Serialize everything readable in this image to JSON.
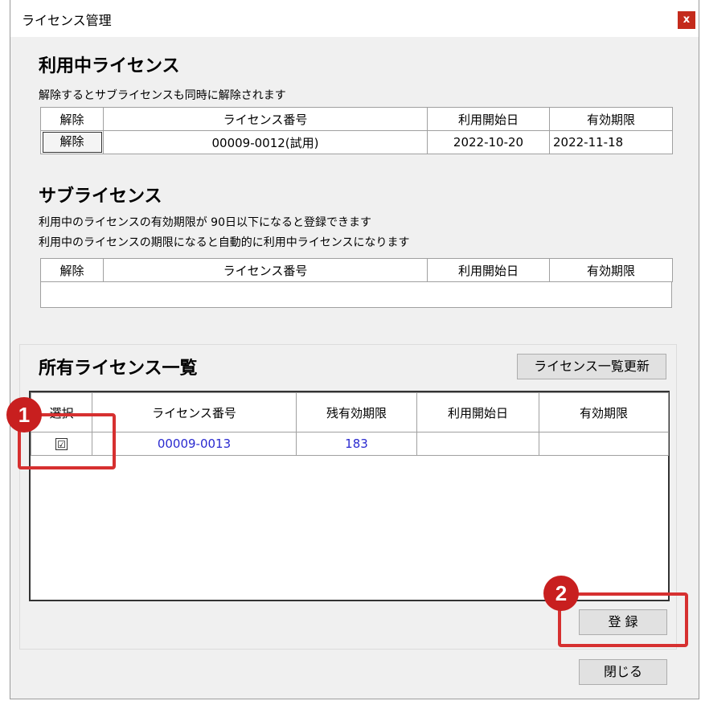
{
  "window": {
    "title": "ライセンス管理",
    "close_label": "x"
  },
  "active": {
    "title": "利用中ライセンス",
    "desc": "解除するとサブライセンスも同時に解除されます",
    "headers": [
      "解除",
      "ライセンス番号",
      "利用開始日",
      "有効期限"
    ],
    "row": {
      "button": "解除",
      "license": "00009-0012(試用)",
      "start": "2022-10-20",
      "expiry": "2022-11-18"
    }
  },
  "sub": {
    "title": "サブライセンス",
    "desc1": "利用中のライセンスの有効期限が 90日以下になると登録できます",
    "desc2": "利用中のライセンスの期限になると自動的に利用中ライセンスになります",
    "headers": [
      "解除",
      "ライセンス番号",
      "利用開始日",
      "有効期限"
    ]
  },
  "owned": {
    "title": "所有ライセンス一覧",
    "refresh_label": "ライセンス一覧更新",
    "headers": [
      "選択",
      "ライセンス番号",
      "残有効期限",
      "利用開始日",
      "有効期限"
    ],
    "rows": [
      {
        "checked": "☑",
        "license": "00009-0013",
        "remaining": "183",
        "start": "",
        "expiry": ""
      }
    ],
    "register_label": "登 録"
  },
  "close_button_label": "閉じる",
  "annotations": {
    "badge1": "1",
    "badge2": "2",
    "accent": "#c81f1f"
  },
  "colors": {
    "link_blue": "#2a2ad0",
    "window_bg": "#f0f0f0"
  }
}
